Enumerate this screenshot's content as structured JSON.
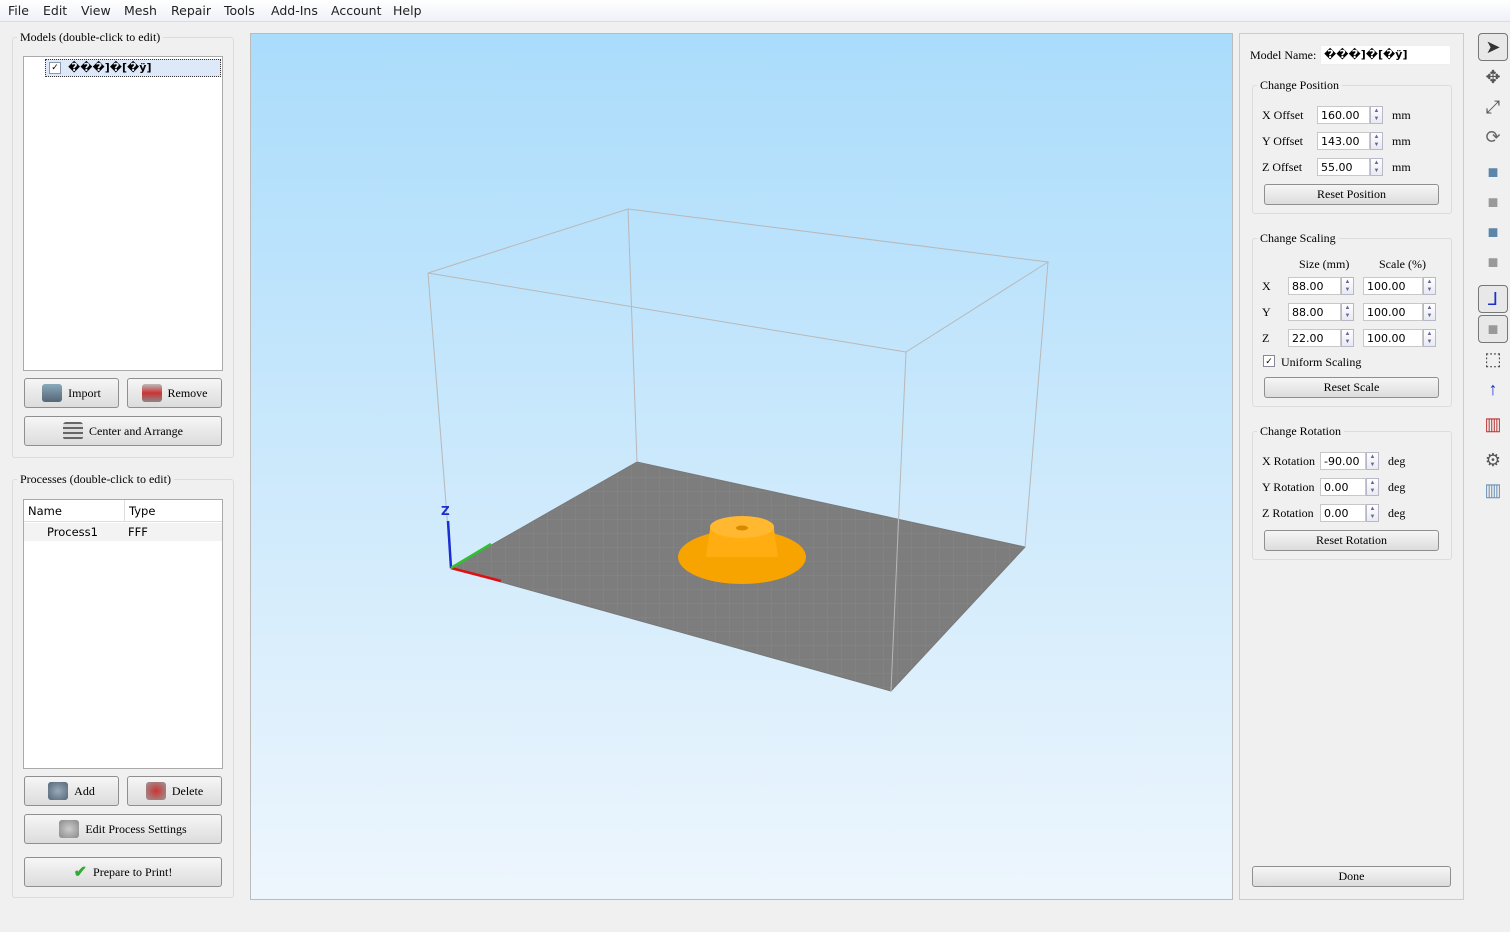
{
  "menu": [
    "File",
    "Edit",
    "View",
    "Mesh",
    "Repair",
    "Tools",
    "Add-Ins",
    "Account",
    "Help"
  ],
  "models": {
    "title": "Models (double-click to edit)",
    "items": [
      {
        "name": "���]�[�ÿ]",
        "checked": true
      }
    ],
    "import": "Import",
    "remove": "Remove",
    "center_arrange": "Center and Arrange"
  },
  "processes": {
    "title": "Processes (double-click to edit)",
    "columns": [
      "Name",
      "Type"
    ],
    "rows": [
      [
        "Process1",
        "FFF"
      ]
    ],
    "add": "Add",
    "delete": "Delete",
    "edit": "Edit Process Settings",
    "prepare": "Prepare to Print!"
  },
  "props": {
    "model_name_label": "Model Name:",
    "model_name": "���]�[�ÿ]",
    "position": {
      "title": "Change Position",
      "x_label": "X Offset",
      "x": "160.00",
      "y_label": "Y Offset",
      "y": "143.00",
      "z_label": "Z Offset",
      "z": "55.00",
      "unit": "mm",
      "reset": "Reset Position"
    },
    "scaling": {
      "title": "Change Scaling",
      "size_header": "Size (mm)",
      "scale_header": "Scale (%)",
      "rows": [
        {
          "axis": "X",
          "size": "88.00",
          "scale": "100.00"
        },
        {
          "axis": "Y",
          "size": "88.00",
          "scale": "100.00"
        },
        {
          "axis": "Z",
          "size": "22.00",
          "scale": "100.00"
        }
      ],
      "uniform": "Uniform Scaling",
      "uniform_checked": true,
      "reset": "Reset Scale"
    },
    "rotation": {
      "title": "Change Rotation",
      "x_label": "X Rotation",
      "x": "-90.00",
      "y_label": "Y Rotation",
      "y": "0.00",
      "z_label": "Z Rotation",
      "z": "0.00",
      "unit": "deg",
      "reset": "Reset Rotation"
    },
    "done": "Done"
  },
  "viewport": {
    "axis_label": "Z",
    "model_color": "#ffa500"
  },
  "toolbar": [
    "select-arrow-icon",
    "move-icon",
    "scale-icon",
    "rotate-icon",
    "view-top-icon",
    "view-front-icon",
    "view-side-icon",
    "view-iso-icon",
    "show-axes-icon",
    "solid-view-icon",
    "wireframe-icon",
    "normal-icon",
    "section-icon",
    "settings-gear-icon",
    "supports-icon"
  ]
}
